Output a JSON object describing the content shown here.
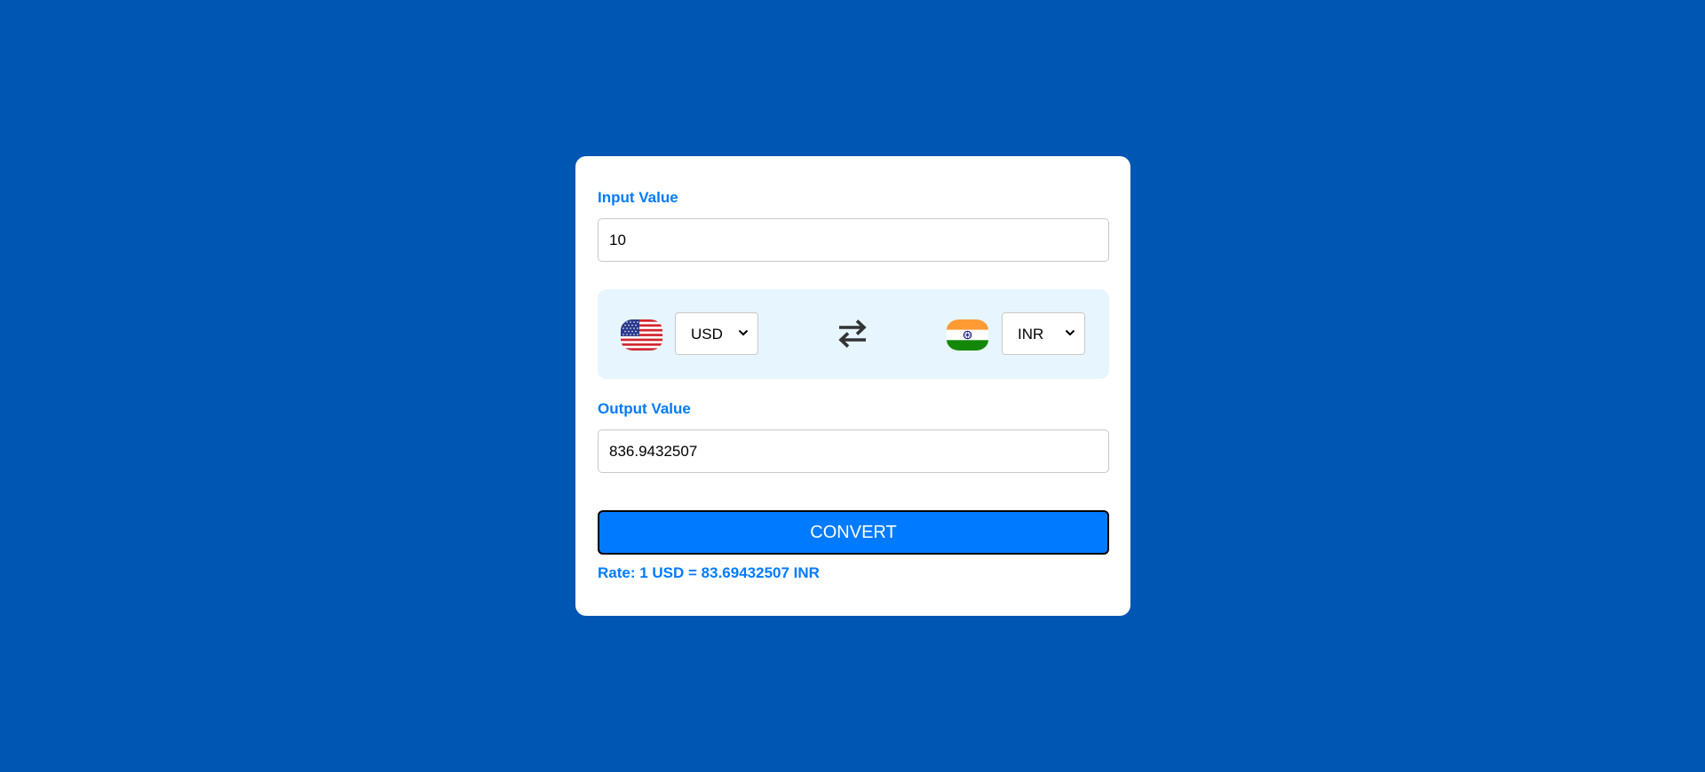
{
  "input": {
    "label": "Input Value",
    "value": "10"
  },
  "converter": {
    "from": {
      "currency": "USD",
      "flag_icon": "us-flag-icon"
    },
    "to": {
      "currency": "INR",
      "flag_icon": "india-flag-icon"
    },
    "swap_icon": "swap-arrows-icon"
  },
  "output": {
    "label": "Output Value",
    "value": "836.9432507"
  },
  "convert_button": {
    "label": "CONVERT"
  },
  "rate_text": "Rate: 1 USD = 83.69432507 INR",
  "colors": {
    "background": "#0056b3",
    "accent": "#007bff",
    "panel": "#e6f5fe",
    "card": "#ffffff"
  }
}
